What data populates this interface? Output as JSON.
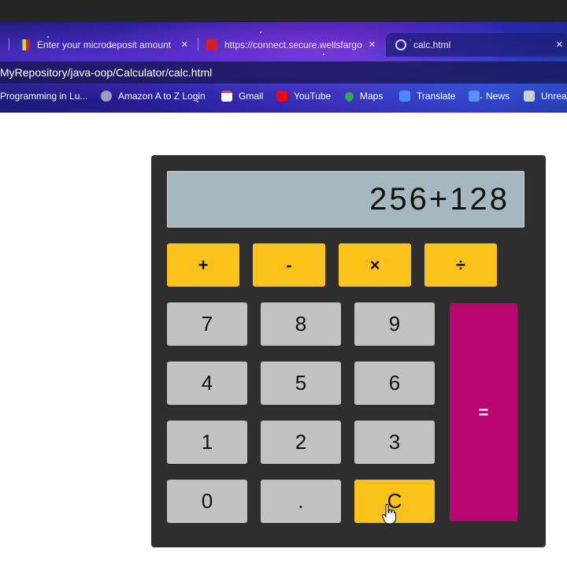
{
  "browser": {
    "tabs": [
      {
        "title": "Enter your microdeposit amount",
        "favicon": "flag-icon"
      },
      {
        "title": "https://connect.secure.wellsfargo",
        "favicon": "wells-fargo-icon"
      },
      {
        "title": "calc.html",
        "favicon": "globe-icon",
        "active": true
      }
    ],
    "close_glyph": "×",
    "address": "MyRepository/java-oop/Calculator/calc.html",
    "bookmarks": [
      {
        "label": "Programming in Lu...",
        "icon": "none"
      },
      {
        "label": "Amazon A to Z Login",
        "icon": "globe-icon"
      },
      {
        "label": "Gmail",
        "icon": "gmail-icon"
      },
      {
        "label": "YouTube",
        "icon": "youtube-icon"
      },
      {
        "label": "Maps",
        "icon": "maps-pin-icon"
      },
      {
        "label": "Translate",
        "icon": "translate-icon"
      },
      {
        "label": "News",
        "icon": "news-icon"
      },
      {
        "label": "Unrea",
        "icon": "unreal-icon"
      }
    ]
  },
  "calculator": {
    "display": "256+128",
    "operators": [
      "+",
      "-",
      "×",
      "÷"
    ],
    "rows": [
      [
        "7",
        "8",
        "9"
      ],
      [
        "4",
        "5",
        "6"
      ],
      [
        "1",
        "2",
        "3"
      ],
      [
        "0",
        ".",
        "C"
      ]
    ],
    "equals": "=",
    "colors": {
      "body": "#2e2e2e",
      "display": "#a6b8bf",
      "operator": "#fbc21a",
      "number": "#c2c2c2",
      "equals": "#b8066e",
      "clear": "#fbc21a"
    }
  }
}
